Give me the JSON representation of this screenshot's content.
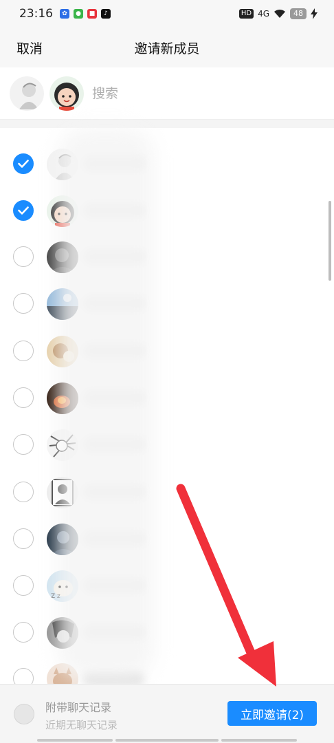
{
  "status_bar": {
    "time": "23:16",
    "hd_label": "HD",
    "network_label": "4G",
    "battery": "48",
    "app_icons": [
      "baidu-icon",
      "wechat-icon",
      "xiaohongshu-icon",
      "douyin-icon"
    ]
  },
  "header": {
    "cancel_label": "取消",
    "title": "邀请新成员"
  },
  "search": {
    "placeholder": "搜索"
  },
  "contacts": [
    {
      "checked": true,
      "avatar": "sketch-avatar"
    },
    {
      "checked": true,
      "avatar": "cartoon-avatar"
    },
    {
      "checked": false,
      "avatar": "dark-photo-avatar"
    },
    {
      "checked": false,
      "avatar": "sky-photo-avatar"
    },
    {
      "checked": false,
      "avatar": "warm-photo-avatar"
    },
    {
      "checked": false,
      "avatar": "fire-photo-avatar"
    },
    {
      "checked": false,
      "avatar": "manga-avatar"
    },
    {
      "checked": false,
      "avatar": "portrait-avatar"
    },
    {
      "checked": false,
      "avatar": "blue-photo-avatar"
    },
    {
      "checked": false,
      "avatar": "dog-avatar"
    },
    {
      "checked": false,
      "avatar": "grey-anime-avatar"
    },
    {
      "checked": false,
      "avatar": "cat-avatar"
    }
  ],
  "bottom": {
    "history_title": "附带聊天记录",
    "history_subtitle": "近期无聊天记录",
    "invite_label": "立即邀请(2)"
  },
  "colors": {
    "accent": "#1a8cff",
    "annotation_arrow": "#f0303a"
  }
}
